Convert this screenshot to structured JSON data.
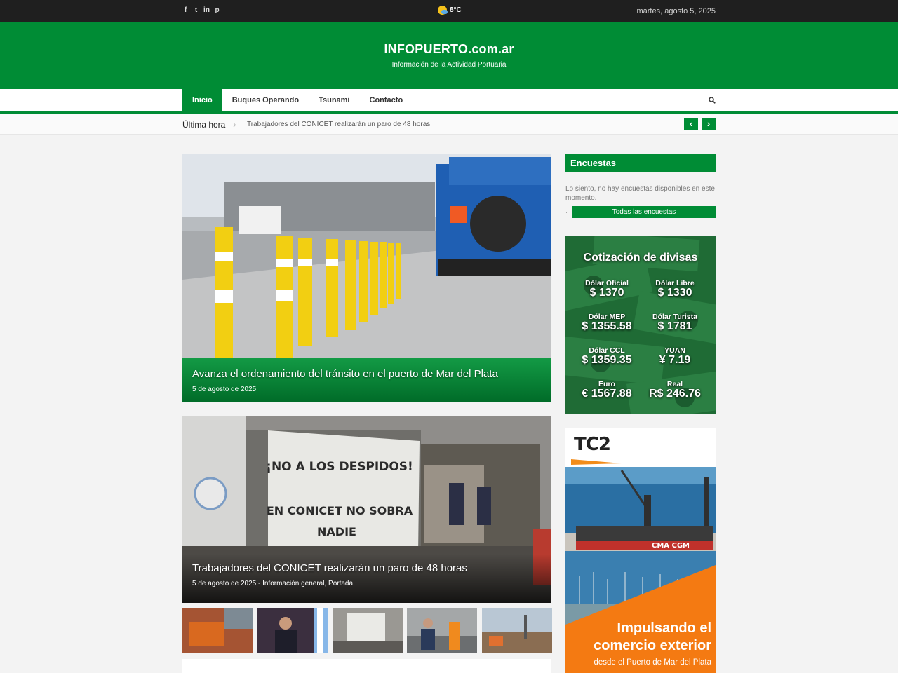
{
  "topbar": {
    "social": [
      {
        "icon": "facebook-icon",
        "glyph": "f"
      },
      {
        "icon": "twitter-icon",
        "glyph": "t"
      },
      {
        "icon": "linkedin-icon",
        "glyph": "in"
      },
      {
        "icon": "pinterest-icon",
        "glyph": "p"
      }
    ],
    "weather": {
      "icon": "partly-sunny-icon",
      "temp": "8°C"
    },
    "date": "martes, agosto 5, 2025"
  },
  "header": {
    "title": "INFOPUERTO.com.ar",
    "tagline": "Información de la Actividad Portuaria",
    "bg_color": "#008c35"
  },
  "nav": {
    "items": [
      "Inicio",
      "Buques Operando",
      "Tsunami",
      "Contacto"
    ],
    "active": "Inicio"
  },
  "ticker": {
    "label": "Última hora",
    "text": "Trabajadores del CONICET realizarán un paro de 48 horas",
    "prev": "‹",
    "next": "›"
  },
  "posts": [
    {
      "title": "Avanza el ordenamiento del tránsito en el puerto de Mar del Plata",
      "meta": "5 de agosto de 2025"
    },
    {
      "title": "Trabajadores del CONICET realizarán un paro de 48 horas",
      "meta": "5 de agosto de 2025 - Información general, Portada",
      "sign": {
        "line1": "¡NO A LOS DESPIDOS!",
        "line2": "EN CONICET NO SOBRA",
        "line3": "NADIE"
      }
    }
  ],
  "sidebar": {
    "polls": {
      "title": "Encuestas",
      "text": "Lo siento, no hay encuestas disponibles en este momento.",
      "button": "Todas las encuestas"
    },
    "divisas": {
      "title": "Cotización de divisas",
      "rates": [
        {
          "name": "Dólar Oficial",
          "value": "$ 1370"
        },
        {
          "name": "Dólar Libre",
          "value": "$ 1330"
        },
        {
          "name": "Dólar MEP",
          "value": "$ 1355.58"
        },
        {
          "name": "Dólar Turista",
          "value": "$ 1781"
        },
        {
          "name": "Dólar CCL",
          "value": "$ 1359.35"
        },
        {
          "name": "YUAN",
          "value": "¥ 7.19"
        },
        {
          "name": "Euro",
          "value": "€ 1567.88"
        },
        {
          "name": "Real",
          "value": "R$ 246.76"
        }
      ]
    },
    "ad": {
      "logo": "TC2",
      "headline_line1": "Impulsando el",
      "headline_line2": "comercio exterior",
      "subline": "desde el Puerto de Mar del Plata",
      "ship_text": "CMA CGM"
    }
  }
}
